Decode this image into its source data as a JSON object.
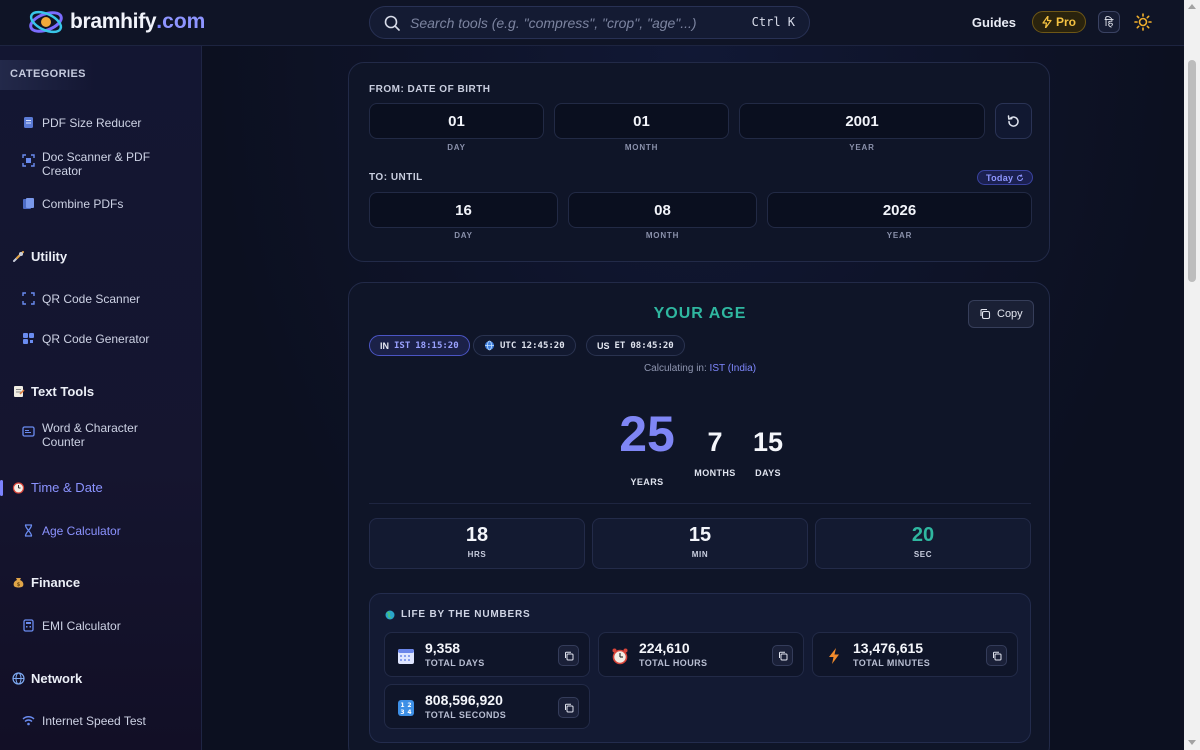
{
  "header": {
    "logo_name": "bramhify",
    "logo_dot": ".",
    "logo_tld": "com",
    "search_placeholder": "Search tools (e.g. \"compress\", \"crop\", \"age\"...)",
    "search_shortcut": "Ctrl K",
    "guides_label": "Guides",
    "pro_label": "Pro",
    "lang_label": "हि"
  },
  "sidebar": {
    "categories_title": "CATEGORIES",
    "pdf_items": [
      {
        "label": "PDF Size Reducer",
        "icon": "document-icon"
      },
      {
        "label": "Doc Scanner & PDF Creator",
        "icon": "scan-icon"
      },
      {
        "label": "Combine PDFs",
        "icon": "files-icon"
      }
    ],
    "groups": {
      "utility": {
        "label": "Utility",
        "icon": "tools-icon",
        "items": [
          "QR Code Scanner",
          "QR Code Generator"
        ]
      },
      "text": {
        "label": "Text Tools",
        "icon": "memo-icon",
        "items": [
          "Word & Character Counter"
        ]
      },
      "time": {
        "label": "Time & Date",
        "icon": "alarm-clock-icon",
        "items": [
          "Age Calculator"
        ]
      },
      "finance": {
        "label": "Finance",
        "icon": "money-bag-icon",
        "items": [
          "EMI Calculator"
        ]
      },
      "network": {
        "label": "Network",
        "icon": "globe-icon",
        "items": [
          "Internet Speed Test"
        ]
      }
    }
  },
  "from": {
    "label": "FROM: DATE OF BIRTH",
    "day": "01",
    "month": "01",
    "year": "2001",
    "day_cap": "DAY",
    "month_cap": "MONTH",
    "year_cap": "YEAR"
  },
  "to": {
    "label": "TO: UNTIL",
    "today_label": "Today",
    "day": "16",
    "month": "08",
    "year": "2026",
    "day_cap": "DAY",
    "month_cap": "MONTH",
    "year_cap": "YEAR"
  },
  "result": {
    "title": "YOUR AGE",
    "copy_label": "Copy",
    "timezones": [
      {
        "cc": "IN",
        "zone": "IST",
        "time": "18:15:20",
        "active": true
      },
      {
        "cc": "",
        "zone": "UTC",
        "time": "12:45:20",
        "active": false
      },
      {
        "cc": "US",
        "zone": "ET",
        "time": "08:45:20",
        "active": false
      }
    ],
    "calc_prefix": "Calculating in:",
    "calc_zone": "IST (India)",
    "years": "25",
    "years_cap": "YEARS",
    "months": "7",
    "months_cap": "MONTHS",
    "days": "15",
    "days_cap": "DAYS",
    "hrs": "18",
    "hrs_cap": "HRS",
    "min": "15",
    "min_cap": "MIN",
    "sec": "20",
    "sec_cap": "SEC"
  },
  "life": {
    "title": "LIFE BY THE NUMBERS",
    "items": [
      {
        "value": "9,358",
        "caption": "TOTAL DAYS",
        "icon": "calendar-icon"
      },
      {
        "value": "224,610",
        "caption": "TOTAL HOURS",
        "icon": "alarm-clock-icon"
      },
      {
        "value": "13,476,615",
        "caption": "TOTAL MINUTES",
        "icon": "lightning-icon"
      },
      {
        "value": "808,596,920",
        "caption": "TOTAL SECONDS",
        "icon": "numbers-icon"
      }
    ]
  },
  "colors": {
    "accent": "#7c83ff",
    "teal": "#2fb7a0",
    "pro": "#f5c342",
    "background": "#0c1020"
  }
}
